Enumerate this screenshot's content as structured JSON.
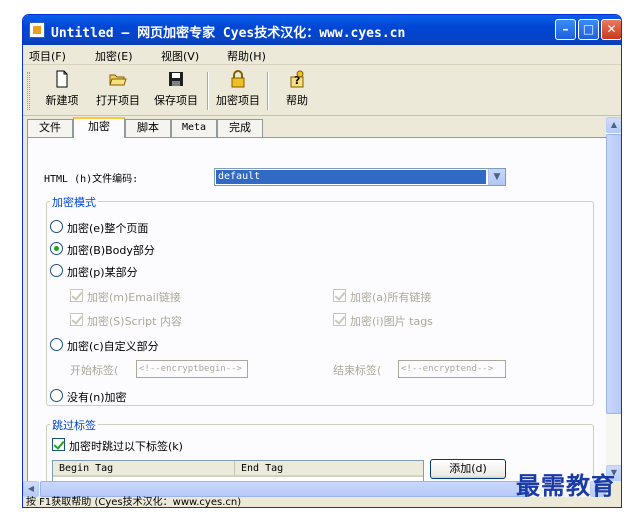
{
  "window": {
    "title": "Untitled – 网页加密专家 Cyes技术汉化：www.cyes.cn",
    "min_glyph": "–",
    "max_glyph": "□",
    "close_glyph": "✕"
  },
  "menu": [
    {
      "label": "项目(F)"
    },
    {
      "label": "加密(E)"
    },
    {
      "label": "视图(V)"
    },
    {
      "label": "帮助(H)"
    }
  ],
  "toolbar": [
    {
      "label": "新建项",
      "icon": "new-file-icon"
    },
    {
      "label": "打开项目",
      "icon": "open-folder-icon"
    },
    {
      "label": "保存项目",
      "icon": "save-disk-icon"
    },
    {
      "label": "加密项目",
      "icon": "lock-icon"
    },
    {
      "label": "帮助",
      "icon": "help-icon"
    }
  ],
  "tabs": [
    {
      "label": "文件",
      "active": false
    },
    {
      "label": "加密",
      "active": true
    },
    {
      "label": "脚本",
      "active": false
    },
    {
      "label": "Meta",
      "active": false
    },
    {
      "label": "完成",
      "active": false
    }
  ],
  "encoding": {
    "label": "HTML (h)文件编码:",
    "value": "default"
  },
  "encrypt_mode": {
    "title": "加密模式",
    "whole_page": "加密(e)整个页面",
    "body_part": "加密(B)Body部分",
    "some_part": "加密(p)某部分",
    "email_links": "加密(m)Email链接",
    "all_links": "加密(a)所有链接",
    "script_content": "加密(S)Script 内容",
    "image_tags": "加密(i)图片 tags",
    "custom_part": "加密(c)自定义部分",
    "start_tag_label": "开始标签(",
    "start_tag_value": "<!--encryptbegin-->",
    "end_tag_label": "结束标签(",
    "end_tag_value": "<!--encryptend-->",
    "no_encrypt": "没有(n)加密",
    "selected": "body_part"
  },
  "skip_tags": {
    "title": "跳过标签",
    "checkbox_label": "加密时跳过以下标签(k)",
    "checked": true,
    "columns": [
      "Begin Tag",
      "End Tag"
    ],
    "add_button": "添加(d)"
  },
  "status": {
    "text": "按 F1获取帮助 (Cyes技术汉化：www.cyes.cn)"
  },
  "watermark": {
    "text": "最需教育"
  },
  "colors": {
    "titlebar": "#0a5fe8",
    "group_title": "#0046d5",
    "selection": "#316ac5",
    "check": "#21a121"
  }
}
